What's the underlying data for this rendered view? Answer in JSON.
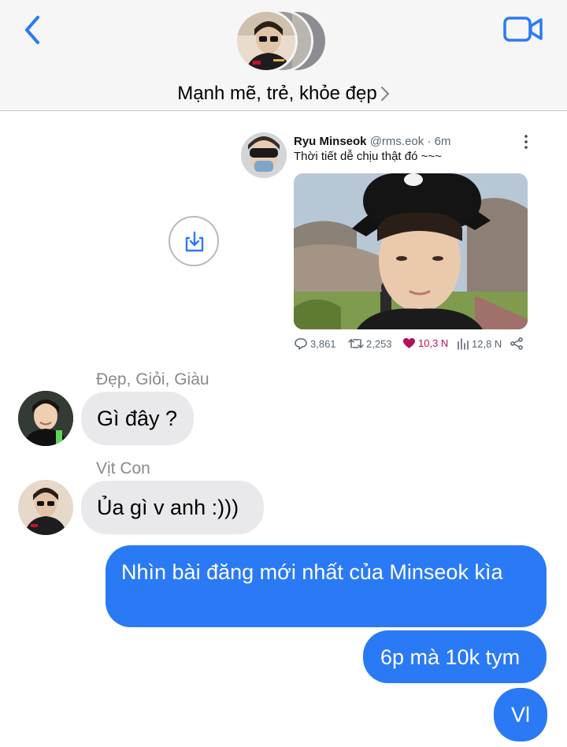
{
  "header": {
    "group_name": "Mạnh mẽ, trẻ, khỏe đẹp",
    "back_icon": "chevron-left-icon",
    "video_icon": "video-camera-icon",
    "accent_color": "#2a7af6"
  },
  "tweet": {
    "author_name": "Ryu Minseok",
    "handle": "@rms.eok",
    "separator": "·",
    "time": "6m",
    "text": "Thời tiết dễ chịu thật đó ~~~",
    "stats": {
      "replies": "3,861",
      "retweets": "2,253",
      "likes": "10,3 N",
      "views": "12,8 N"
    },
    "like_color": "#b5125c"
  },
  "save_button_icon": "download-icon",
  "messages": [
    {
      "sender": "Đẹp, Giỏi, Giàu",
      "text": "Gì đây ?",
      "direction": "incoming"
    },
    {
      "sender": "Vịt Con",
      "text": "Ủa gì v anh :)))",
      "direction": "incoming"
    },
    {
      "text": "Nhìn bài đăng mới nhất của Minseok kìa",
      "direction": "outgoing"
    },
    {
      "text": "6p mà 10k tym",
      "direction": "outgoing"
    },
    {
      "text": "Vl",
      "direction": "outgoing"
    }
  ],
  "colors": {
    "incoming_bubble": "#e9e9eb",
    "outgoing_bubble": "#2a7af6",
    "header_bg": "#f6f6f7"
  }
}
